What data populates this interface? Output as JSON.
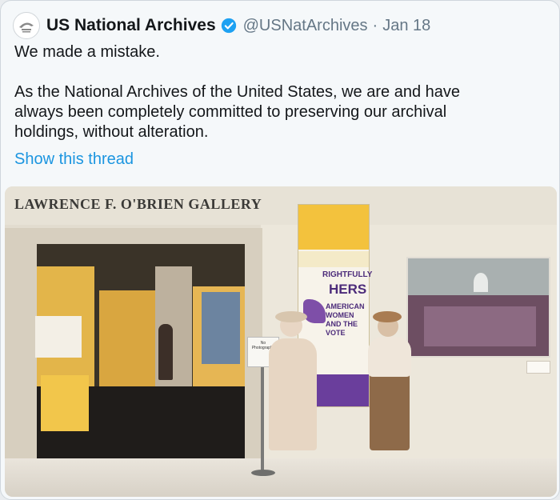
{
  "tweet": {
    "author_name": "US National Archives",
    "handle": "@USNatArchives",
    "separator": "·",
    "date": "Jan 18",
    "line1": "We made a mistake.",
    "body_lines": [
      "As the National Archives of the United States, we are and have",
      "always been completely committed to preserving our archival",
      "holdings, without alteration."
    ],
    "thread_link": "Show this thread"
  },
  "photo": {
    "gallery_sign": "LAWRENCE F. O'BRIEN GALLERY",
    "banner_line1": "RIGHTFULLY",
    "banner_line2": "HERS",
    "banner_line3": "AMERICAN WOMEN AND THE VOTE",
    "sign_text": "No Photography"
  },
  "colors": {
    "link": "#1b95e0",
    "verified": "#1da1f2",
    "text": "#14171a",
    "muted": "#657786"
  }
}
